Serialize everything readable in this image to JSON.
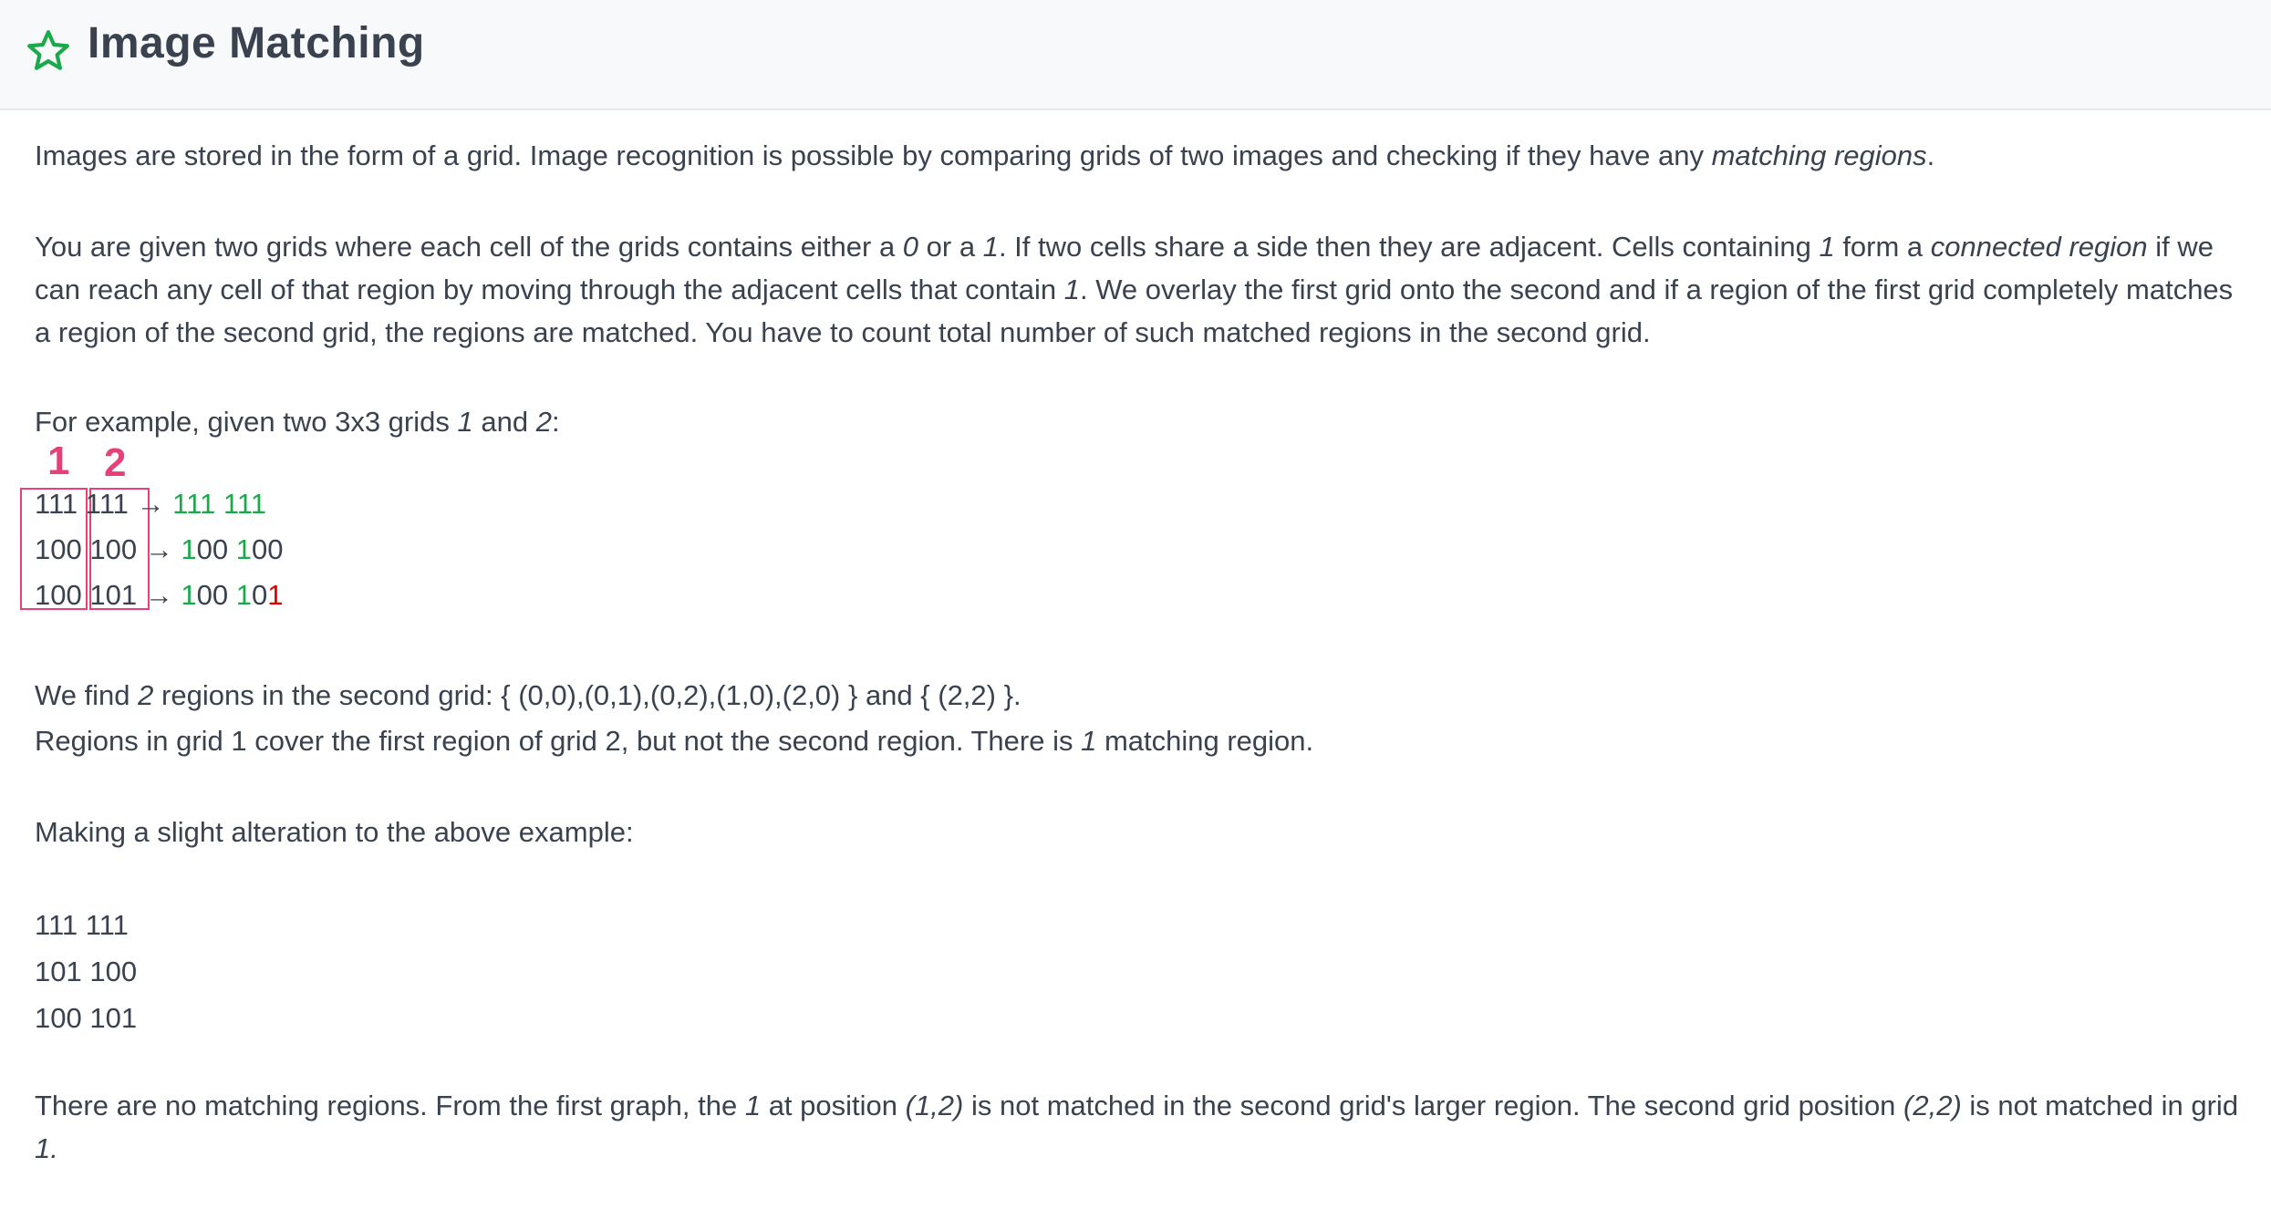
{
  "header": {
    "title": "Image Matching",
    "icon": "star-icon",
    "accent": "#1ba94c"
  },
  "intro": {
    "before": "Images are stored in the form of a grid. Image recognition is possible by comparing grids of two images and checking if they have any ",
    "em": "matching regions",
    "after": "."
  },
  "desc": {
    "a": "You are given two grids where each cell of the grids contains either a ",
    "b": "0",
    "c": " or a ",
    "d": "1",
    "e": ". If two cells share a side then they are adjacent. Cells containing ",
    "f": "1",
    "g": " form a ",
    "h": "connected region",
    "i": " if we can reach any cell of that region by moving through the adjacent cells that contain ",
    "j": "1",
    "k": ". We overlay the first grid onto the second and if a region of the first grid completely matches a region of the second grid, the regions are matched. You have to count total number of such matched regions in the second grid."
  },
  "example_intro": {
    "a": "For example, given two 3x3 grids ",
    "b": "1",
    "c": " and ",
    "d": "2",
    "e": ":"
  },
  "example": {
    "label1": "1",
    "label2": "2",
    "arrow": "→",
    "rows": [
      {
        "g1": "111",
        "g2": "111",
        "r1": "111",
        "r2": "111"
      },
      {
        "g1": "100",
        "g2": "100",
        "r1": "100",
        "r2": "100"
      },
      {
        "g1": "100",
        "g2": "101",
        "r1": "100",
        "r2": "101"
      }
    ]
  },
  "find": {
    "a": "We find ",
    "b": "2",
    "c": " regions in the second grid: { (0,0),(0,1),(0,2),(1,0),(2,0) } and { (2,2) }."
  },
  "cover": {
    "a": "Regions in grid 1 cover the first region of grid 2, but not the second region. There is ",
    "b": "1",
    "c": " matching region."
  },
  "alter": "Making a slight alteration to the above example:",
  "grid2": [
    "111 111",
    "101 100",
    "100 101"
  ],
  "final": {
    "a": "There are no matching regions. From the first graph, the ",
    "b": "1",
    "c": " at position ",
    "d": "(1,2)",
    "e": " is not matched in the second grid's larger region. The second grid position ",
    "f": "(2,2)",
    "g": " is not matched in grid ",
    "h": "1."
  }
}
